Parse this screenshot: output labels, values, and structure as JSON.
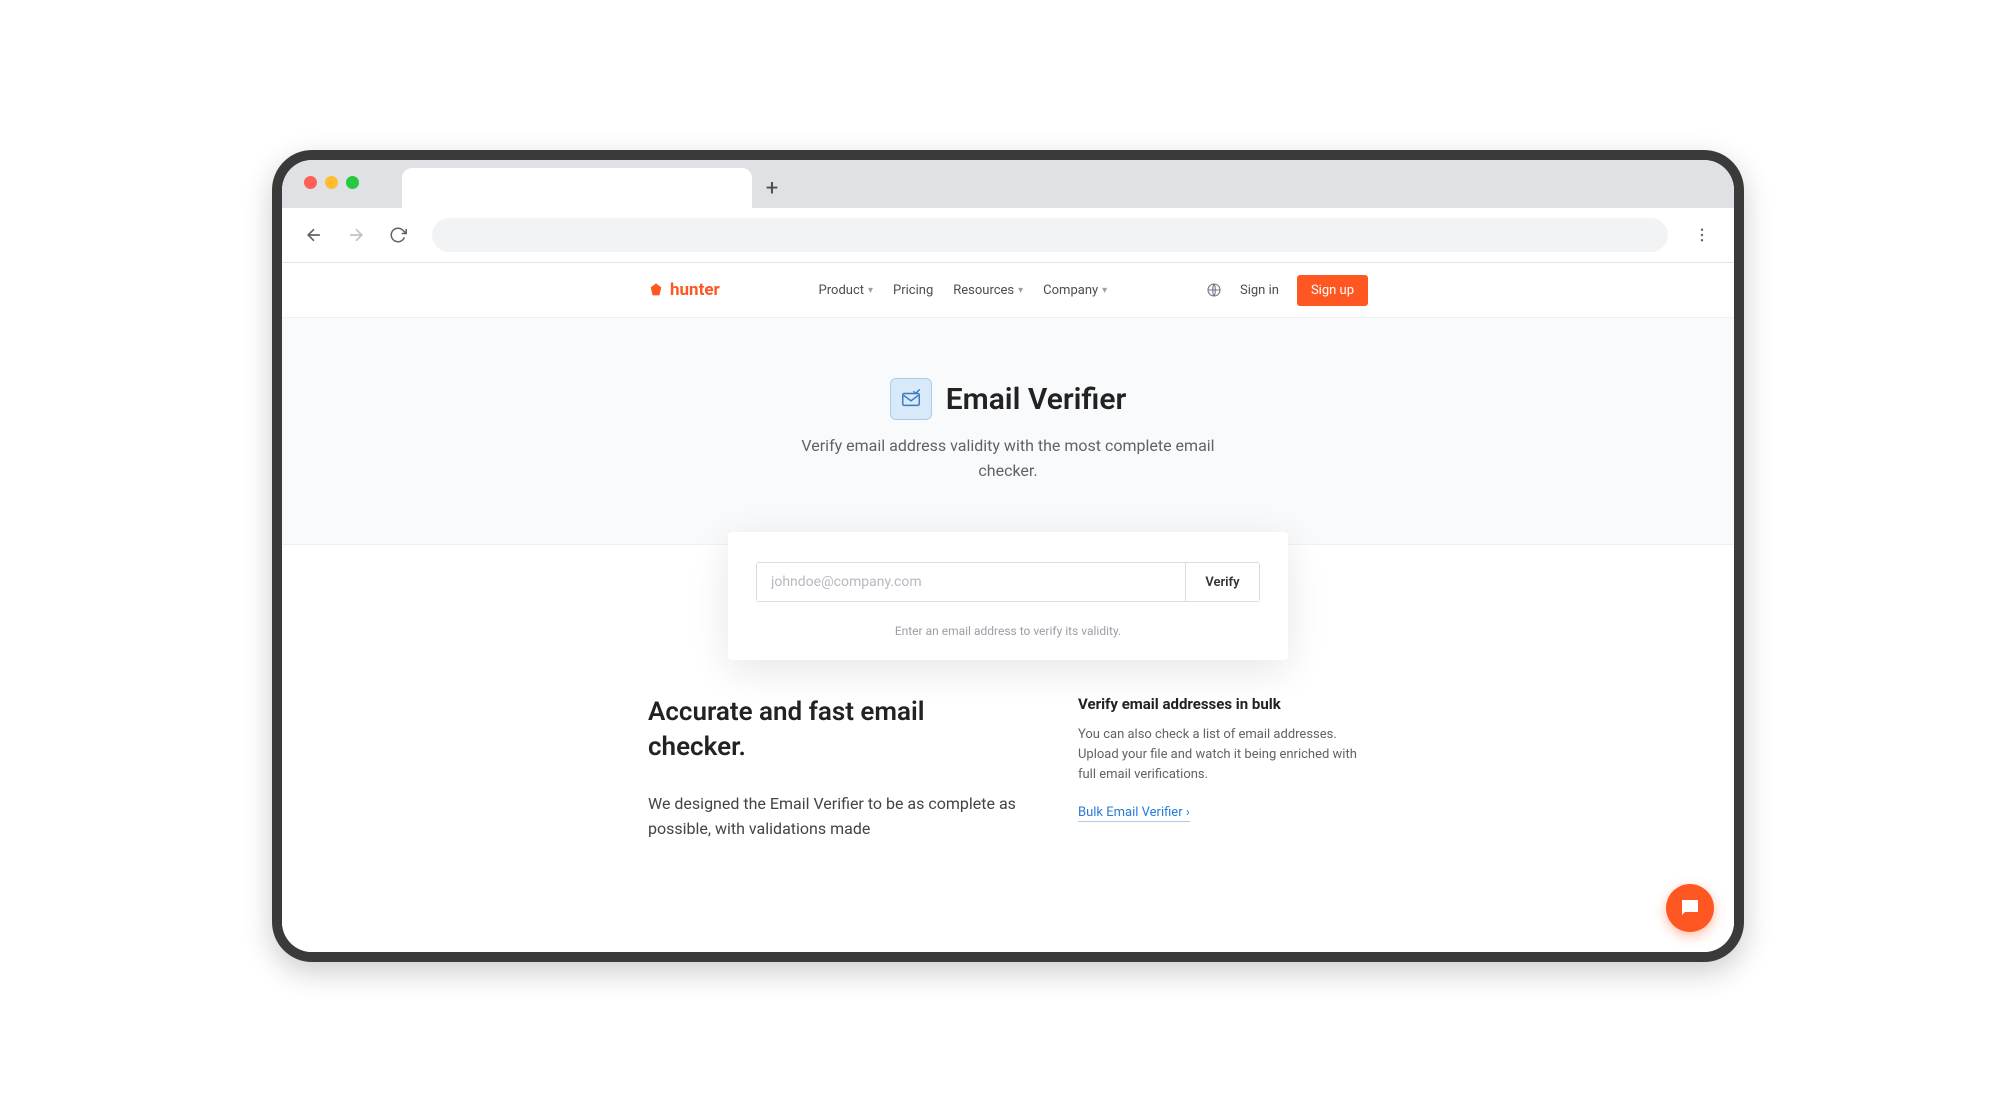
{
  "browser": {
    "new_tab_glyph": "+"
  },
  "header": {
    "logo_text": "hunter",
    "nav": [
      {
        "label": "Product",
        "has_dropdown": true
      },
      {
        "label": "Pricing",
        "has_dropdown": false
      },
      {
        "label": "Resources",
        "has_dropdown": true
      },
      {
        "label": "Company",
        "has_dropdown": true
      }
    ],
    "signin": "Sign in",
    "signup": "Sign up"
  },
  "hero": {
    "title": "Email Verifier",
    "subtitle": "Verify email address validity with the most complete email checker."
  },
  "card": {
    "email_placeholder": "johndoe@company.com",
    "verify_label": "Verify",
    "help": "Enter an email address to verify its validity."
  },
  "section": {
    "left_heading": "Accurate and fast email checker.",
    "left_body": "We designed the Email Verifier to be as complete as possible, with validations made",
    "right_heading": "Verify email addresses in bulk",
    "right_body": "You can also check a list of email addresses. Upload your file and watch it being enriched with full email verifications.",
    "right_link": "Bulk Email Verifier ›"
  }
}
